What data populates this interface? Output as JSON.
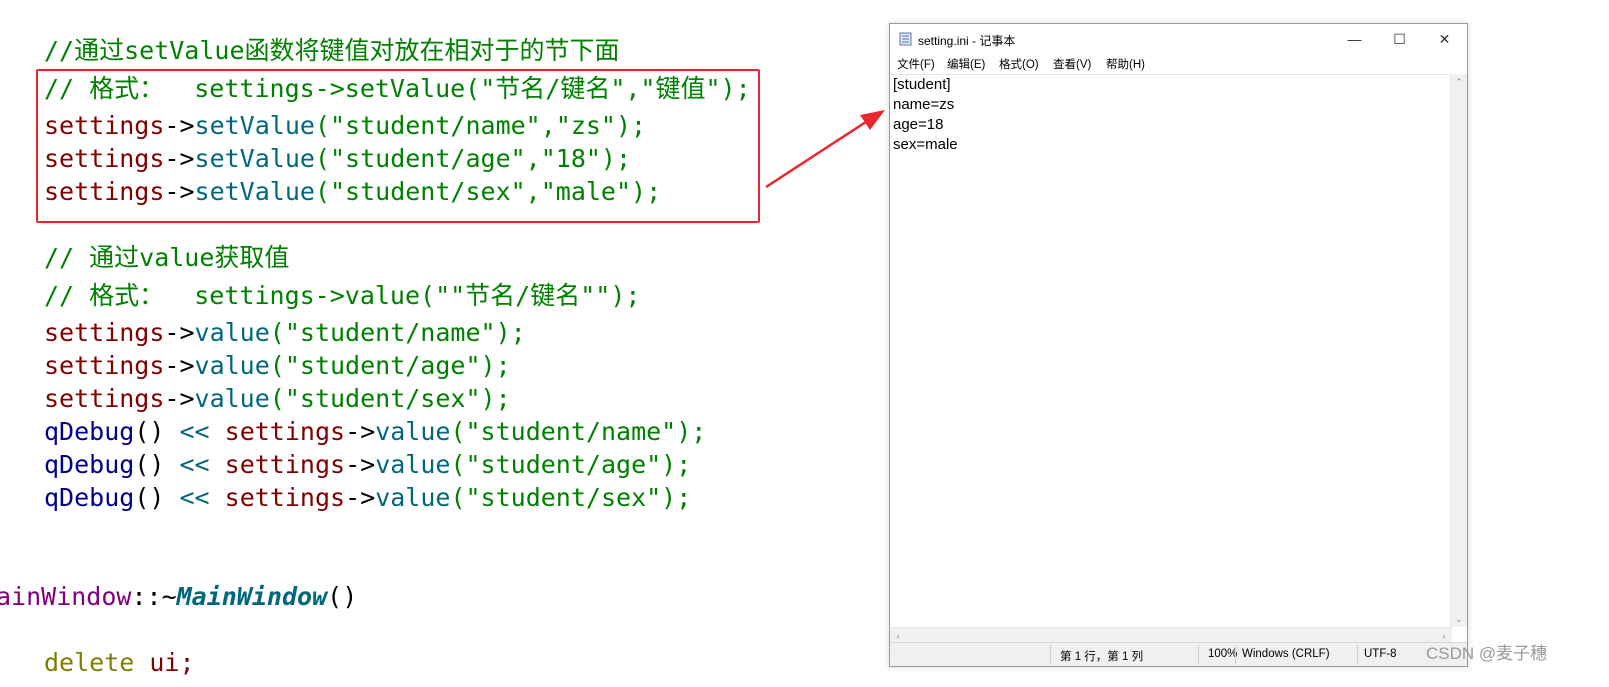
{
  "code": {
    "comment_setvalue": "//通过setValue函数将键值对放在相对于的节下面",
    "comment_format1": "// 格式：  settings->setValue(\"节名/键名\",\"键值\");",
    "set_name": {
      "obj": "settings",
      "arrow": "->",
      "fn": "setValue",
      "args": "(\"student/name\",\"zs\");"
    },
    "set_age": {
      "obj": "settings",
      "arrow": "->",
      "fn": "setValue",
      "args": "(\"student/age\",\"18\");"
    },
    "set_sex": {
      "obj": "settings",
      "arrow": "->",
      "fn": "setValue",
      "args": "(\"student/sex\",\"male\");"
    },
    "comment_value": "// 通过value获取值",
    "comment_format2": "// 格式：  settings->value(\"\"节名/键名\"\");",
    "get_name": {
      "obj": "settings",
      "arrow": "->",
      "fn": "value",
      "args": "(\"student/name\");"
    },
    "get_age": {
      "obj": "settings",
      "arrow": "->",
      "fn": "value",
      "args": "(\"student/age\");"
    },
    "get_sex": {
      "obj": "settings",
      "arrow": "->",
      "fn": "value",
      "args": "(\"student/sex\");"
    },
    "debug_name": {
      "dbg": "qDebug",
      "paren": "()",
      "shift": "<<",
      "obj": "settings",
      "arrow": "->",
      "fn": "value",
      "args": "(\"student/name\");"
    },
    "debug_age": {
      "dbg": "qDebug",
      "paren": "()",
      "shift": "<<",
      "obj": "settings",
      "arrow": "->",
      "fn": "value",
      "args": "(\"student/age\");"
    },
    "debug_sex": {
      "dbg": "qDebug",
      "paren": "()",
      "shift": "<<",
      "obj": "settings",
      "arrow": "->",
      "fn": "value",
      "args": "(\"student/sex\");"
    },
    "dtor_class": "ainWindow",
    "dtor_sep": "::~",
    "dtor_name": "MainWindow",
    "dtor_paren": "()",
    "delete_kw": "delete",
    "delete_rest": "ui;"
  },
  "notepad": {
    "title": "setting.ini - 记事本",
    "minimize": "—",
    "maximize": "☐",
    "close": "✕",
    "menu": [
      "文件(F)",
      "编辑(E)",
      "格式(O)",
      "查看(V)",
      "帮助(H)"
    ],
    "lines": [
      "[student]",
      "name=zs",
      "age=18",
      "sex=male"
    ],
    "status": {
      "position": "第 1 行，第 1 列",
      "zoom": "100%",
      "line_ending": "Windows (CRLF)",
      "encoding": "UTF-8"
    }
  },
  "watermark": "CSDN @麦子穗",
  "colors": {
    "highlight": "#e8262c",
    "arrow": "#e8262c"
  }
}
